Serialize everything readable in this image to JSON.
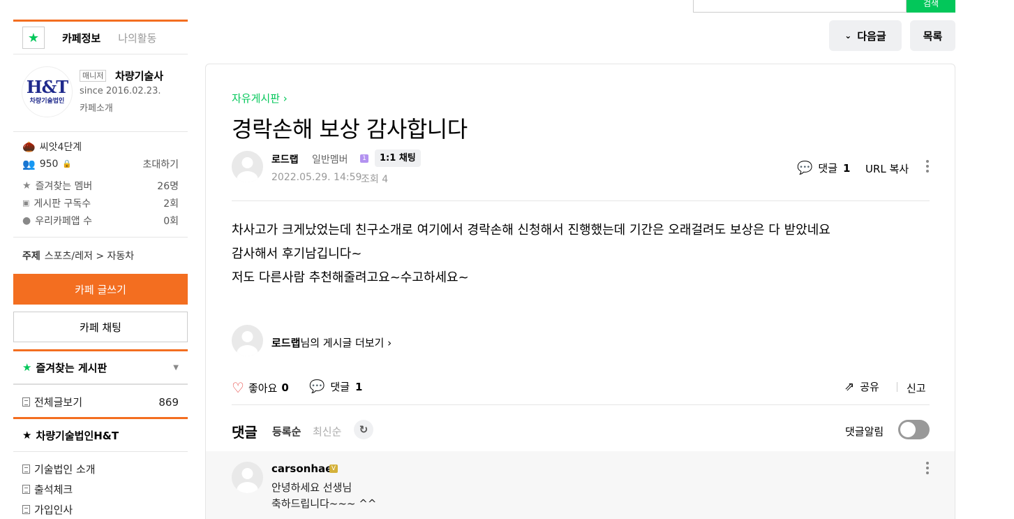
{
  "top": {
    "search_btn": "검색"
  },
  "sidebar": {
    "tabs": [
      {
        "label": "카페정보"
      },
      {
        "label": "나의활동"
      }
    ],
    "manager_badge": "매니저",
    "cafe_name": "차량기술사",
    "since": "since 2016.02.23.",
    "intro": "카페소개",
    "logo_text": "H&T",
    "logo_sub": "차량기술법인",
    "grade": "씨앗4단계",
    "members": "950",
    "invite": "초대하기",
    "stats": [
      {
        "label": "즐겨찾는 멤버",
        "value": "26명"
      },
      {
        "label": "게시판 구독수",
        "value": "2회"
      },
      {
        "label": "우리카페앱 수",
        "value": "0회"
      }
    ],
    "topic_label": "주제",
    "topic_value": "스포츠/레저 > 자동차",
    "write_btn": "카페 글쓰기",
    "chat_btn": "카페 채팅",
    "fav_board": "즐겨찾는 게시판",
    "all_posts": "전체글보기",
    "all_posts_count": "869",
    "group_title": "차량기술법인H&T",
    "group_items": [
      "기술법인 소개",
      "출석체크",
      "가입인사"
    ]
  },
  "nav": {
    "next": "다음글",
    "list": "목록"
  },
  "article": {
    "board": "자유게시판",
    "title": "경락손해 보상 감사합니다",
    "author": "로드랩",
    "level": "일반멤버",
    "level_num": "1",
    "chat": "1:1 채팅",
    "date": "2022.05.29. 14:59",
    "views": "조회 4",
    "comment_label": "댓글",
    "comment_count": "1",
    "url_copy": "URL 복사",
    "body": [
      "차사고가 크게났었는데 친구소개로 여기에서  경락손해 신청해서 진행했는데 기간은 오래걸려도 보상은 다 받았네요",
      "감사해서 후기남깁니다~",
      "저도 다른사람 추천해줄려고요~수고하세요~"
    ],
    "more_author": "로드랩",
    "more_suffix": "님의 게시글 더보기",
    "like_label": "좋아요",
    "like_count": "0",
    "share": "공유",
    "report": "신고"
  },
  "comments": {
    "header": "댓글",
    "sort_reg": "등록순",
    "sort_new": "최신순",
    "notify": "댓글알림",
    "notify_on": false,
    "items": [
      {
        "author": "carsonhae",
        "lines": [
          "안녕하세요 선생님",
          "축하드립니다~~~ ^^"
        ]
      }
    ]
  },
  "colors": {
    "accent_green": "#03c75a",
    "accent_orange": "#f36e20"
  }
}
